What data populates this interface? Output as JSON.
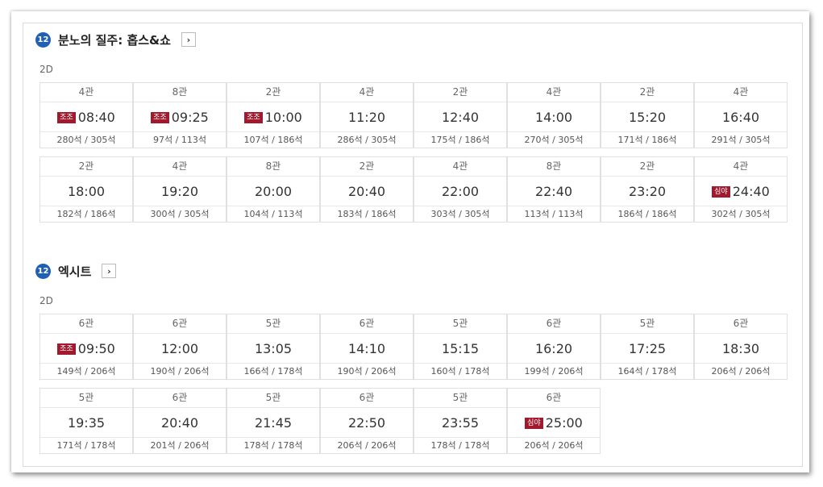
{
  "movies": [
    {
      "age": "12",
      "title": "분노의 질주: 홉스&쇼",
      "arrow": "›",
      "format": "2D",
      "showtimes": [
        {
          "hall": "4관",
          "tag": "조조",
          "time": "08:40",
          "seats": "280석 / 305석"
        },
        {
          "hall": "8관",
          "tag": "조조",
          "time": "09:25",
          "seats": "97석 / 113석"
        },
        {
          "hall": "2관",
          "tag": "조조",
          "time": "10:00",
          "seats": "107석 / 186석"
        },
        {
          "hall": "4관",
          "tag": "",
          "time": "11:20",
          "seats": "286석 / 305석"
        },
        {
          "hall": "2관",
          "tag": "",
          "time": "12:40",
          "seats": "175석 / 186석"
        },
        {
          "hall": "4관",
          "tag": "",
          "time": "14:00",
          "seats": "270석 / 305석"
        },
        {
          "hall": "2관",
          "tag": "",
          "time": "15:20",
          "seats": "171석 / 186석"
        },
        {
          "hall": "4관",
          "tag": "",
          "time": "16:40",
          "seats": "291석 / 305석"
        },
        {
          "hall": "2관",
          "tag": "",
          "time": "18:00",
          "seats": "182석 / 186석"
        },
        {
          "hall": "4관",
          "tag": "",
          "time": "19:20",
          "seats": "300석 / 305석"
        },
        {
          "hall": "8관",
          "tag": "",
          "time": "20:00",
          "seats": "104석 / 113석"
        },
        {
          "hall": "2관",
          "tag": "",
          "time": "20:40",
          "seats": "183석 / 186석"
        },
        {
          "hall": "4관",
          "tag": "",
          "time": "22:00",
          "seats": "303석 / 305석"
        },
        {
          "hall": "8관",
          "tag": "",
          "time": "22:40",
          "seats": "113석 / 113석"
        },
        {
          "hall": "2관",
          "tag": "",
          "time": "23:20",
          "seats": "186석 / 186석"
        },
        {
          "hall": "4관",
          "tag": "심야",
          "time": "24:40",
          "seats": "302석 / 305석"
        }
      ]
    },
    {
      "age": "12",
      "title": "엑시트",
      "arrow": "›",
      "format": "2D",
      "showtimes": [
        {
          "hall": "6관",
          "tag": "조조",
          "time": "09:50",
          "seats": "149석 / 206석"
        },
        {
          "hall": "6관",
          "tag": "",
          "time": "12:00",
          "seats": "190석 / 206석"
        },
        {
          "hall": "5관",
          "tag": "",
          "time": "13:05",
          "seats": "166석 / 178석"
        },
        {
          "hall": "6관",
          "tag": "",
          "time": "14:10",
          "seats": "190석 / 206석"
        },
        {
          "hall": "5관",
          "tag": "",
          "time": "15:15",
          "seats": "160석 / 178석"
        },
        {
          "hall": "6관",
          "tag": "",
          "time": "16:20",
          "seats": "199석 / 206석"
        },
        {
          "hall": "5관",
          "tag": "",
          "time": "17:25",
          "seats": "164석 / 178석"
        },
        {
          "hall": "6관",
          "tag": "",
          "time": "18:30",
          "seats": "206석 / 206석"
        },
        {
          "hall": "5관",
          "tag": "",
          "time": "19:35",
          "seats": "171석 / 178석"
        },
        {
          "hall": "6관",
          "tag": "",
          "time": "20:40",
          "seats": "201석 / 206석"
        },
        {
          "hall": "5관",
          "tag": "",
          "time": "21:45",
          "seats": "178석 / 178석"
        },
        {
          "hall": "6관",
          "tag": "",
          "time": "22:50",
          "seats": "206석 / 206석"
        },
        {
          "hall": "5관",
          "tag": "",
          "time": "23:55",
          "seats": "178석 / 178석"
        },
        {
          "hall": "6관",
          "tag": "심야",
          "time": "25:00",
          "seats": "206석 / 206석"
        }
      ]
    }
  ],
  "colors": {
    "age_badge": "#1f5fb4",
    "tag": "#a2192e"
  }
}
